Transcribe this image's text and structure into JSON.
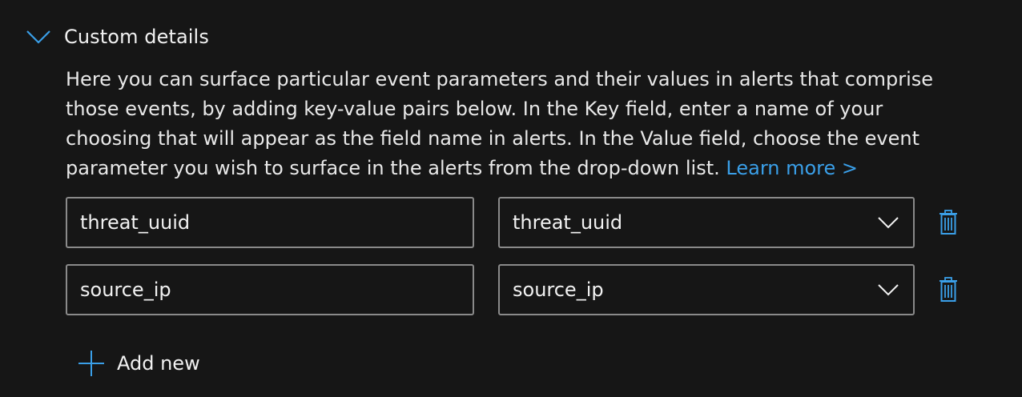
{
  "section": {
    "title": "Custom details",
    "expanded_icon": "chevron-down-icon",
    "description": "Here you can surface particular event parameters and their values in alerts that comprise those events, by adding key-value pairs below. In the Key field, enter a name of your choosing that will appear as the field name in alerts. In the Value field, choose the event parameter you wish to surface in the alerts from the drop-down list.",
    "learn_more": "Learn more >"
  },
  "rows": [
    {
      "key": "threat_uuid",
      "value": "threat_uuid",
      "delete_icon": "trash-icon"
    },
    {
      "key": "source_ip",
      "value": "source_ip",
      "delete_icon": "trash-icon"
    }
  ],
  "add_new": {
    "label": "Add new",
    "icon": "plus-icon"
  },
  "colors": {
    "background": "#161616",
    "accent": "#3a9fe8",
    "border": "#8a8a8a",
    "text": "#f2f2f2"
  }
}
